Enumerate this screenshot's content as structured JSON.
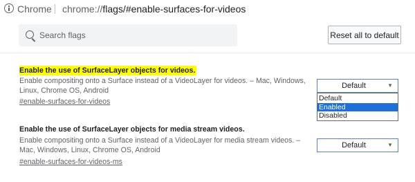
{
  "omnibox": {
    "site_label": "Chrome",
    "url_host": "chrome://",
    "url_path": "flags/#enable-surfaces-for-videos"
  },
  "header": {
    "search_placeholder": "Search flags",
    "search_value": "",
    "reset_label": "Reset all to default"
  },
  "flags": [
    {
      "title": "Enable the use of SurfaceLayer objects for videos.",
      "highlighted": true,
      "description_line1": "Enable compositing onto a Surface instead of a VideoLayer for videos. – Mac, Windows,",
      "description_line2": "Linux, Chrome OS, Android",
      "link": "#enable-surfaces-for-videos",
      "select_value": "Default",
      "dropdown_open": true,
      "options": [
        "Default",
        "Enabled",
        "Disabled"
      ],
      "highlighted_option": "Enabled"
    },
    {
      "title": "Enable the use of SurfaceLayer objects for media stream videos.",
      "highlighted": false,
      "description_line1": "Enable compositing onto a Surface instead of a VideoLayer for media stream videos. –",
      "description_line2": "Mac, Windows, Linux, Chrome OS, Android",
      "link": "#enable-surfaces-for-videos-ms",
      "select_value": "Default",
      "dropdown_open": false
    }
  ],
  "colors": {
    "highlight": "#ffff00",
    "selected_option": "#1e6fd9",
    "select_border": "#5b7fc4"
  }
}
